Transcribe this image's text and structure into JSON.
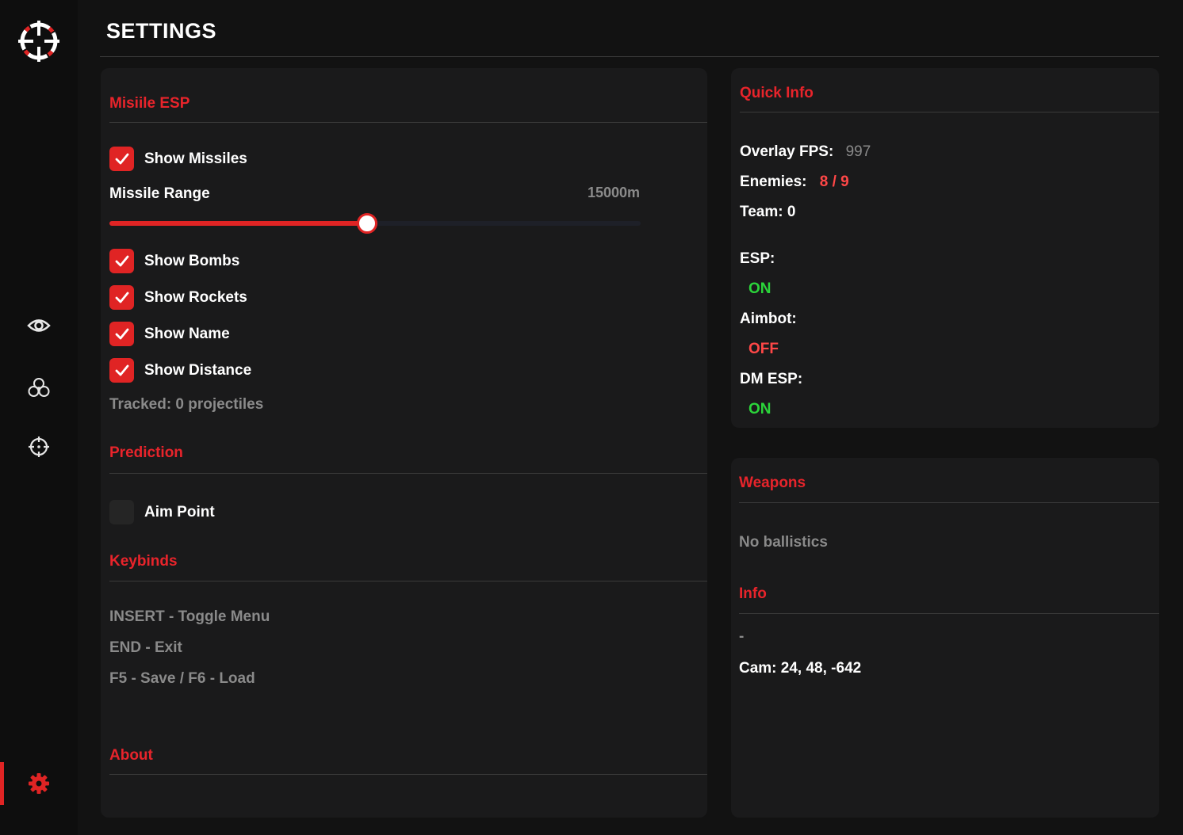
{
  "page": {
    "title": "SETTINGS"
  },
  "sidebar": {
    "items": [
      {
        "icon": "eye-icon"
      },
      {
        "icon": "radiation-icon"
      },
      {
        "icon": "crosshair-icon"
      },
      {
        "icon": "gear-icon",
        "active": true
      }
    ],
    "accent": "#e02424"
  },
  "missile_esp": {
    "title": "Misiile ESP",
    "show_missiles": {
      "label": "Show Missiles",
      "checked": true
    },
    "range": {
      "label": "Missile Range",
      "value_text": "15000m",
      "fraction": 0.485
    },
    "show_bombs": {
      "label": "Show Bombs",
      "checked": true
    },
    "show_rockets": {
      "label": "Show Rockets",
      "checked": true
    },
    "show_name": {
      "label": "Show Name",
      "checked": true
    },
    "show_distance": {
      "label": "Show Distance",
      "checked": true
    },
    "tracked": "Tracked: 0 projectiles"
  },
  "prediction": {
    "title": "Prediction",
    "aim_point": {
      "label": "Aim Point",
      "checked": false
    }
  },
  "keybinds": {
    "title": "Keybinds",
    "lines": [
      "INSERT - Toggle Menu",
      "END - Exit",
      "F5 - Save / F6 - Load"
    ]
  },
  "about": {
    "title": "About"
  },
  "quick_info": {
    "title": "Quick Info",
    "fps_label": "Overlay FPS:",
    "fps_value": "997",
    "enemies_label": "Enemies:",
    "enemies_value": "8 / 9",
    "team": "Team: 0",
    "esp_label": "ESP:",
    "esp_value": "ON",
    "aimbot_label": "Aimbot:",
    "aimbot_value": "OFF",
    "dm_esp_label": "DM ESP:",
    "dm_esp_value": "ON"
  },
  "weapons": {
    "title": "Weapons",
    "text": "No ballistics"
  },
  "info": {
    "title": "Info",
    "dash": "-",
    "cam": "Cam: 24, 48, -642"
  },
  "colors": {
    "accent": "#e8242b",
    "on": "#2bd43a",
    "off": "#ff4747",
    "muted": "#8a8a8a"
  }
}
